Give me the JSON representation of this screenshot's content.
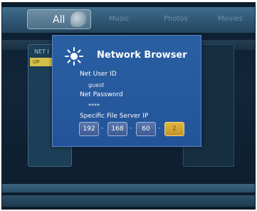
{
  "tabs": [
    {
      "label": "All",
      "active": true
    },
    {
      "label": "Music",
      "active": false
    },
    {
      "label": "Photos",
      "active": false
    },
    {
      "label": "Movies",
      "active": false
    }
  ],
  "left_panel": {
    "header": "NET I",
    "item": "UP"
  },
  "dialog": {
    "title": "Network Browser",
    "icon": "network-sun-icon",
    "user_id_label": "Net User ID",
    "user_id_value": "guest",
    "password_label": "Net Password",
    "password_value": "****",
    "server_ip_label": "Specific File Server IP",
    "ip_octets": [
      "192",
      "168",
      "60",
      "2"
    ],
    "ip_separator": "-",
    "focused_octet": 3
  },
  "colors": {
    "dialog_bg": "#2a5fa2",
    "focus": "#d6a63a",
    "topbar": "#2f5672"
  }
}
